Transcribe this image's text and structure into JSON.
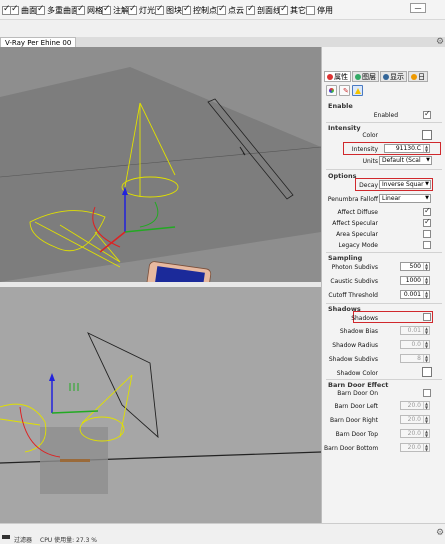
{
  "window": {
    "minimize_label": "—"
  },
  "filter_bar": {
    "items": [
      {
        "label": "",
        "checked": true
      },
      {
        "label": "曲面",
        "checked": true
      },
      {
        "label": "多重曲面",
        "checked": true
      },
      {
        "label": "网格",
        "checked": true
      },
      {
        "label": "注解",
        "checked": true
      },
      {
        "label": "灯光",
        "checked": true
      },
      {
        "label": "图块",
        "checked": true
      },
      {
        "label": "控制点",
        "checked": true
      },
      {
        "label": "点云",
        "checked": true
      },
      {
        "label": "剖面线",
        "checked": true
      },
      {
        "label": "其它",
        "checked": true
      },
      {
        "label": "停用",
        "checked": false
      }
    ]
  },
  "viewport": {
    "tab_label": "V-Ray Per Ehine 00"
  },
  "panel": {
    "tabs": [
      {
        "label": "属性",
        "icon": "properties-icon",
        "color": "#d33"
      },
      {
        "label": "图层",
        "icon": "layers-icon",
        "color": "#3a6"
      },
      {
        "label": "显示",
        "icon": "display-icon",
        "color": "#369"
      },
      {
        "label": "日",
        "icon": "sun-icon",
        "color": "#e90"
      }
    ],
    "icons": [
      "material-icon",
      "light-icon",
      "vray-light-icon"
    ],
    "enable": {
      "section": "Enable",
      "enabled_label": "Enabled",
      "enabled": true
    },
    "intensity": {
      "section": "Intensity",
      "color_label": "Color",
      "color": "#ffffff",
      "intensity_label": "Intensity",
      "intensity_value": "91130.C",
      "units_label": "Units",
      "units_value": "Default (Scal"
    },
    "options": {
      "section": "Options",
      "decay_label": "Decay",
      "decay_value": "Inverse Squar",
      "penumbra_label": "Penumbra Falloff",
      "penumbra_value": "Linear",
      "affect_diffuse_label": "Affect Diffuse",
      "affect_diffuse": true,
      "affect_specular_label": "Affect Specular",
      "affect_specular": true,
      "area_specular_label": "Area Specular",
      "area_specular": false,
      "legacy_mode_label": "Legacy Mode",
      "legacy_mode": false
    },
    "sampling": {
      "section": "Sampling",
      "photon_label": "Photon Subdivs",
      "photon_value": "500",
      "caustic_label": "Caustic Subdivs",
      "caustic_value": "1000",
      "cutoff_label": "Cutoff Threshold",
      "cutoff_value": "0.001"
    },
    "shadows": {
      "section": "Shadows",
      "shadows_label": "Shadows",
      "shadows": false,
      "bias_label": "Shadow Bias",
      "bias_value": "0.01",
      "radius_label": "Shadow Radius",
      "radius_value": "0.0",
      "subdivs_label": "Shadow Subdivs",
      "subdivs_value": "8",
      "color_label": "Shadow Color",
      "color": "#ffffff"
    },
    "barn_door": {
      "section": "Barn Door Effect",
      "on_label": "Barn Door On",
      "on": false,
      "left_label": "Barn Door Left",
      "left_value": "20.0",
      "right_label": "Barn Door Right",
      "right_value": "20.0",
      "top_label": "Barn Door Top",
      "top_value": "20.0",
      "bottom_label": "Barn Door Bottom",
      "bottom_value": "20.0"
    }
  },
  "statusbar": {
    "filter": "过滤器",
    "cpu": "CPU 使用量: 27.3 %"
  },
  "colors": {
    "highlight": "#d0282c",
    "light_wire": "#e0e000",
    "axis_x": "#d22",
    "axis_y": "#2a2",
    "axis_z": "#22d"
  }
}
